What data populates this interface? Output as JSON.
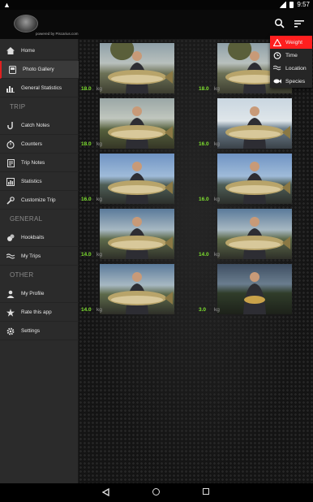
{
  "status": {
    "time": "9:57"
  },
  "app": {
    "powered_by": "powered by Piscarius.com"
  },
  "drawer": {
    "items": [
      {
        "label": "Home",
        "icon": "home-icon",
        "active": false
      },
      {
        "label": "Photo Gallery",
        "icon": "photo-icon",
        "active": true
      },
      {
        "label": "General Statistics",
        "icon": "bar-chart-icon",
        "active": false
      }
    ],
    "sections": [
      {
        "title": "TRIP",
        "items": [
          {
            "label": "Catch Notes",
            "icon": "fish-hook-icon"
          },
          {
            "label": "Counters",
            "icon": "stopwatch-icon"
          },
          {
            "label": "Trip Notes",
            "icon": "notes-icon"
          },
          {
            "label": "Statistics",
            "icon": "statistics-icon"
          },
          {
            "label": "Customize Trip",
            "icon": "wrench-icon"
          }
        ]
      },
      {
        "title": "GENERAL",
        "items": [
          {
            "label": "Hookbaits",
            "icon": "boilie-icon"
          },
          {
            "label": "My Trips",
            "icon": "waves-icon"
          }
        ]
      },
      {
        "title": "OTHER",
        "items": [
          {
            "label": "My Profile",
            "icon": "person-icon"
          },
          {
            "label": "Rate this app",
            "icon": "star-icon"
          },
          {
            "label": "Settings",
            "icon": "gear-icon"
          }
        ]
      }
    ]
  },
  "gallery": {
    "unit": "kg",
    "photos": [
      {
        "weight": "18.0",
        "scene": "tree"
      },
      {
        "weight": "18.0",
        "scene": "tree"
      },
      {
        "weight": "18.0",
        "scene": "reed"
      },
      {
        "weight": "16.0",
        "scene": "lake"
      },
      {
        "weight": "16.0",
        "scene": "sky"
      },
      {
        "weight": "16.0",
        "scene": "sky"
      },
      {
        "weight": "14.0",
        "scene": "dusk"
      },
      {
        "weight": "14.0",
        "scene": "dusk"
      },
      {
        "weight": "14.0",
        "scene": "dusk"
      },
      {
        "weight": "3.0",
        "scene": "evening"
      }
    ]
  },
  "sort_menu": {
    "options": [
      {
        "label": "Weight",
        "icon": "scale-icon",
        "selected": true
      },
      {
        "label": "Time",
        "icon": "alarm-clock-icon",
        "selected": false
      },
      {
        "label": "Location",
        "icon": "waves-icon",
        "selected": false
      },
      {
        "label": "Species",
        "icon": "fish-icon",
        "selected": false
      }
    ]
  },
  "colors": {
    "accent": "#ff1f1f",
    "weight_text": "#7ee02f",
    "drawer_bg": "#2b2b2b"
  }
}
